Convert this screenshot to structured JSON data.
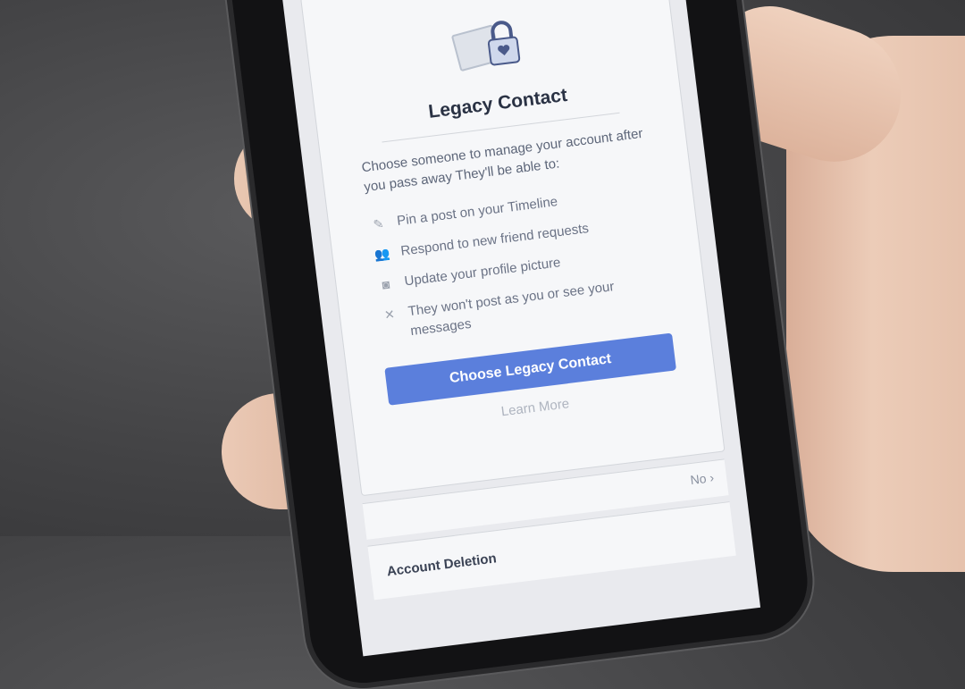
{
  "legacy": {
    "title": "Legacy Contact",
    "description": "Choose someone to manage your account after you pass away  They'll be able to:",
    "items": [
      {
        "icon": "edit-icon",
        "label": "Pin a post on your Timeline"
      },
      {
        "icon": "friends-icon",
        "label": "Respond to new friend requests"
      },
      {
        "icon": "camera-icon",
        "label": "Update your profile picture"
      },
      {
        "icon": "close-icon",
        "label": "They won't post as you or see your messages"
      }
    ],
    "button_label": "Choose Legacy Contact",
    "learn_more": "Learn More"
  },
  "setting_row": {
    "value": "No"
  },
  "account_deletion": {
    "label": "Account Deletion"
  },
  "colors": {
    "accent": "#5b7fdc",
    "title": "#2a3244"
  }
}
